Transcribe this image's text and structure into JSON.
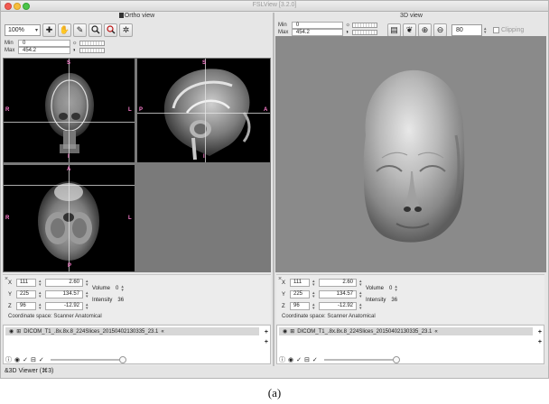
{
  "app": {
    "title": "FSLView [3.2.0]"
  },
  "ortho": {
    "panel_title": "Ortho view",
    "zoom": "100%",
    "min_label": "Min",
    "min_value": "0",
    "max_label": "Max",
    "max_value": "454.2",
    "tools": [
      "cross-icon",
      "hand-icon",
      "pencil-icon",
      "zoom-icon",
      "fill-icon",
      "gear-icon"
    ],
    "axial_orient": {
      "top": "S",
      "bottom": "I",
      "left": "R",
      "right": "L"
    },
    "sagittal_orient": {
      "top": "S",
      "bottom": "I",
      "left": "P",
      "right": "A"
    },
    "coronal_orient": {
      "top": "A",
      "bottom": "P",
      "left": "R",
      "right": "L"
    }
  },
  "viewer3d": {
    "panel_title": "3D view",
    "min_label": "Min",
    "min_value": "0",
    "max_label": "Max",
    "max_value": "454.2",
    "opacity": "80",
    "clipping_label": "Clipping"
  },
  "info_left": {
    "x_label": "X",
    "x_idx": "111",
    "x_coord": "2.60",
    "y_label": "Y",
    "y_idx": "225",
    "y_coord": "134.57",
    "z_label": "Z",
    "z_idx": "96",
    "z_coord": "-12.92",
    "volume_label": "Volume",
    "volume_value": "0",
    "intensity_label": "Intensity",
    "intensity_value": "36",
    "coord_space": "Coordinate space: Scanner Anatomical"
  },
  "info_right": {
    "x_label": "X",
    "x_idx": "111",
    "x_coord": "2.60",
    "y_label": "Y",
    "y_idx": "225",
    "y_coord": "134.57",
    "z_label": "Z",
    "z_idx": "96",
    "z_coord": "-12.92",
    "volume_label": "Volume",
    "volume_value": "0",
    "intensity_label": "Intensity",
    "intensity_value": "36",
    "coord_space": "Coordinate space: Scanner Anatomical"
  },
  "layers": {
    "left_name": "DICOM_T1_.8x.8x.8_224Slices_20150402130335_23.1",
    "right_name": "DICOM_T1_.8x.8x.8_224Slices_20150402130335_23.1",
    "add": "+",
    "remove": "+"
  },
  "status": "&3D Viewer (⌘3)",
  "caption": "(a)",
  "colors": {
    "orient": "#ff7fd0",
    "viewport_bg": "#000000",
    "three_d_bg": "#8a8a8a"
  }
}
